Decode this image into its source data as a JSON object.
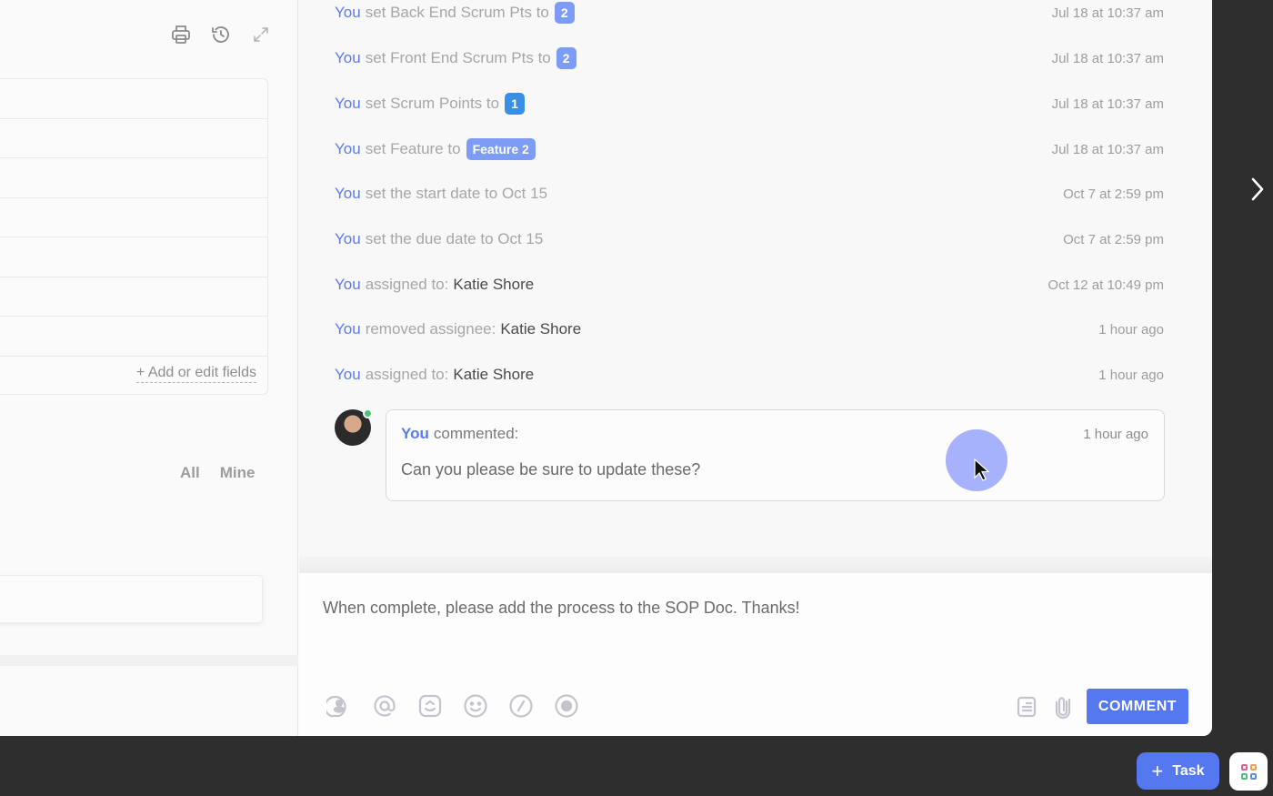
{
  "left_panel": {
    "toolbar": [
      {
        "icon": "printer-icon"
      },
      {
        "icon": "history-icon"
      },
      {
        "icon": "expand-icon"
      }
    ],
    "fields_row_count": 7,
    "add_fields_label": "+ Add or edit fields",
    "filters": {
      "all": "All",
      "mine": "Mine"
    }
  },
  "activity": {
    "items": [
      {
        "actor": "You",
        "action": "set Back End Scrum Pts to",
        "badge": "2",
        "badge_style": "light",
        "time": "Jul 18 at 10:37 am"
      },
      {
        "actor": "You",
        "action": "set Front End Scrum Pts to",
        "badge": "2",
        "badge_style": "light",
        "time": "Jul 18 at 10:37 am"
      },
      {
        "actor": "You",
        "action": "set Scrum Points to",
        "badge": "1",
        "badge_style": "dark",
        "time": "Jul 18 at 10:37 am"
      },
      {
        "actor": "You",
        "action": "set Feature to",
        "badge": "Feature 2",
        "badge_style": "light",
        "time": "Jul 18 at 10:37 am"
      },
      {
        "actor": "You",
        "action": "set the start date to Oct 15",
        "time": "Oct 7 at 2:59 pm"
      },
      {
        "actor": "You",
        "action": "set the due date to Oct 15",
        "time": "Oct 7 at 2:59 pm"
      },
      {
        "actor": "You",
        "action": "assigned to:",
        "target": "Katie Shore",
        "time": "Oct 12 at 10:49 pm"
      },
      {
        "actor": "You",
        "action": "removed assignee:",
        "target": "Katie Shore",
        "time": "1 hour ago"
      },
      {
        "actor": "You",
        "action": "assigned to:",
        "target": "Katie Shore",
        "time": "1 hour ago"
      }
    ],
    "comment": {
      "actor": "You",
      "verb": "commented:",
      "time": "1 hour ago",
      "body": "Can you please be sure to update these?"
    }
  },
  "composer": {
    "value": "When complete, please add the process to the SOP Doc. Thanks!",
    "tools": [
      "assign-comment-icon",
      "mention-icon",
      "reaction-icon",
      "emoji-icon",
      "slash-command-icon",
      "record-icon"
    ],
    "submit_label": "COMMENT"
  },
  "floating": {
    "task_label": "Task",
    "apps_colors": [
      "#e5608a",
      "#f0a04b",
      "#4cbf7a",
      "#5b8ef0"
    ]
  },
  "colors": {
    "accent": "#5578f0",
    "actor": "#5b7cf0",
    "badge_light": "#7c9cf6",
    "badge_dark": "#3a8ee6"
  }
}
